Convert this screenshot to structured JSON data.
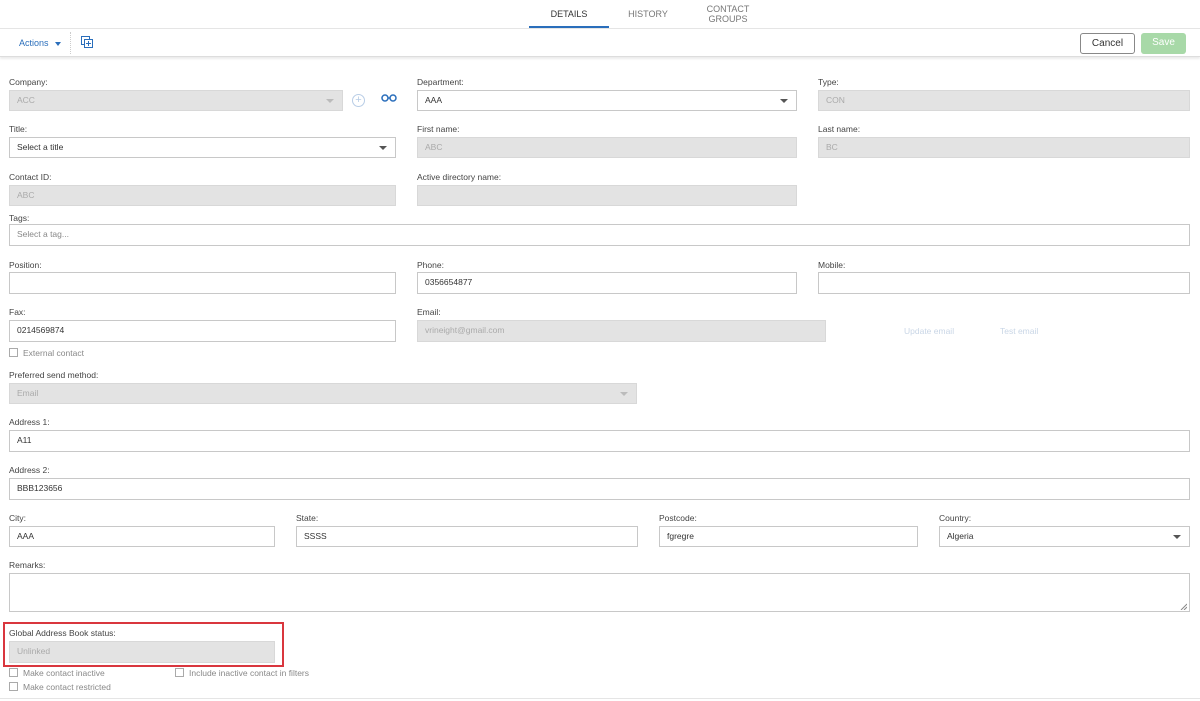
{
  "tabs": [
    {
      "label": "DETAILS"
    },
    {
      "label": "HISTORY"
    },
    {
      "label": "CONTACT GROUPS"
    }
  ],
  "toolbar": {
    "actions": "Actions",
    "cancel": "Cancel",
    "save": "Save"
  },
  "form": {
    "company": {
      "label": "Company:",
      "value": "ACC"
    },
    "department": {
      "label": "Department:",
      "value": "AAA"
    },
    "type": {
      "label": "Type:",
      "value": "CON"
    },
    "title": {
      "label": "Title:",
      "value": "Select a title"
    },
    "first_name": {
      "label": "First name:",
      "value": "ABC"
    },
    "last_name": {
      "label": "Last name:",
      "value": "BC"
    },
    "contact_id": {
      "label": "Contact ID:",
      "value": "ABC"
    },
    "ad_name": {
      "label": "Active directory name:",
      "value": ""
    },
    "tags": {
      "label": "Tags:",
      "placeholder": "Select a tag..."
    },
    "position": {
      "label": "Position:",
      "value": ""
    },
    "phone": {
      "label": "Phone:",
      "value": "0356654877"
    },
    "mobile": {
      "label": "Mobile:",
      "value": ""
    },
    "fax": {
      "label": "Fax:",
      "value": "0214569874"
    },
    "email": {
      "label": "Email:",
      "value": "vrineight@gmail.com"
    },
    "update_email": "Update email",
    "test_email": "Test email",
    "external_contact": "External contact",
    "send_method": {
      "label": "Preferred send method:",
      "value": "Email"
    },
    "address1": {
      "label": "Address 1:",
      "value": "A11"
    },
    "address2": {
      "label": "Address 2:",
      "value": "BBB123656"
    },
    "city": {
      "label": "City:",
      "value": "AAA"
    },
    "state": {
      "label": "State:",
      "value": "SSSS"
    },
    "postcode": {
      "label": "Postcode:",
      "value": "fgregre"
    },
    "country": {
      "label": "Country:",
      "value": "Algeria"
    },
    "remarks": {
      "label": "Remarks:",
      "value": ""
    },
    "gab_status": {
      "label": "Global Address Book status:",
      "value": "Unlinked"
    },
    "make_inactive": "Make contact inactive",
    "include_inactive": "Include inactive contact in filters",
    "make_restricted": "Make contact restricted"
  }
}
